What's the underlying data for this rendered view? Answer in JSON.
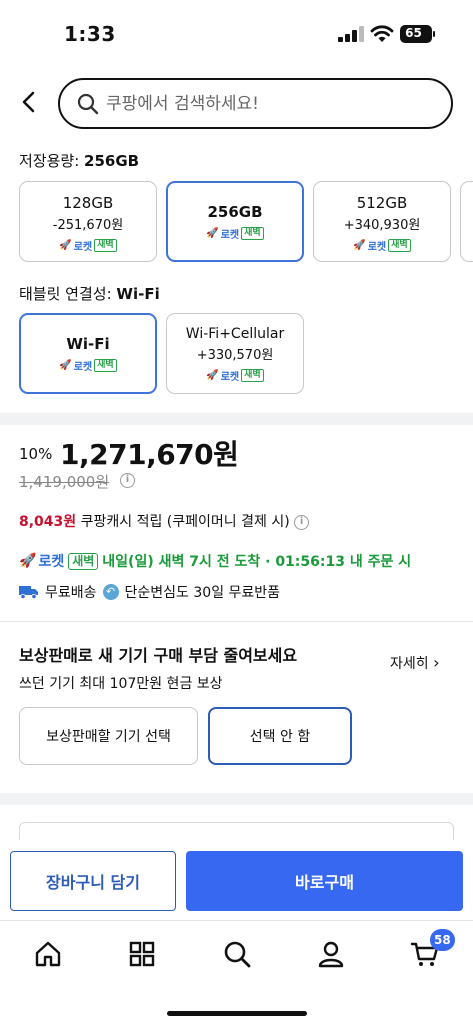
{
  "status_bar": {
    "time": "1:33",
    "battery": "65"
  },
  "search": {
    "placeholder": "쿠팡에서 검색하세요!"
  },
  "storage": {
    "label": "저장용량:",
    "selected": "256GB",
    "options": [
      {
        "name": "128GB",
        "price": "-251,670원",
        "rocket": "로켓",
        "dawn": "새벽"
      },
      {
        "name": "256GB",
        "price": "",
        "rocket": "로켓",
        "dawn": "새벽"
      },
      {
        "name": "512GB",
        "price": "+340,930원",
        "rocket": "로켓",
        "dawn": "새벽"
      }
    ]
  },
  "connectivity": {
    "label": "태블릿 연결성:",
    "selected": "Wi-Fi",
    "options": [
      {
        "name": "Wi-Fi",
        "price": "",
        "rocket": "로켓",
        "dawn": "새벽"
      },
      {
        "name": "Wi-Fi+Cellular",
        "price": "+330,570원",
        "rocket": "로켓",
        "dawn": "새벽"
      }
    ]
  },
  "pricing": {
    "discount": "10%",
    "price": "1,271,670원",
    "original_price": "1,419,000원",
    "cash_amount": "8,043원",
    "cash_text": "쿠팡캐시 적립 (쿠페이머니 결제 시)"
  },
  "delivery": {
    "rocket": "로켓",
    "dawn": "새벽",
    "text": "내일(일) 새벽 7시 전 도착 · 01:56:13 내 주문 시"
  },
  "shipping": {
    "free_shipping": "무료배송",
    "free_return": "단순변심도 30일 무료반품"
  },
  "trade_in": {
    "title": "보상판매로 새 기기 구매 부담 줄여보세요",
    "subtitle": "쓰던 기기 최대 107만원 현금 보상",
    "more": "자세히",
    "choose_label": "보상판매할 기기 선택",
    "none_label": "선택 안 함"
  },
  "actions": {
    "cart": "장바구니 담기",
    "buy": "바로구매"
  },
  "tab_bar": {
    "cart_count": "58"
  },
  "colors": {
    "accent": "#3668f2",
    "selected_border": "#3e73d9",
    "green": "#1a9b3a",
    "cash_red": "#c8102e"
  }
}
